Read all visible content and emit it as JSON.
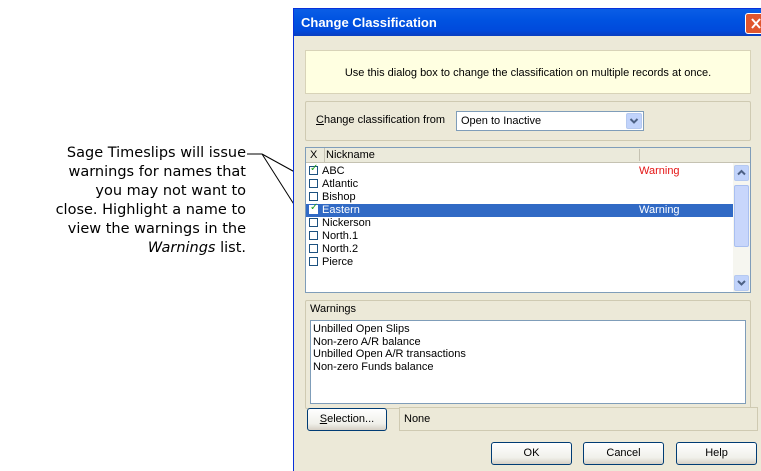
{
  "callout": {
    "line1": "Sage Timeslips will issue",
    "line2": "warnings for names that",
    "line3": "you may not want to",
    "line4": "close. Highlight a name to",
    "line5": "view the warnings in the",
    "line6_italic": "Warnings",
    "line6_rest": " list."
  },
  "dialog": {
    "title": "Change Classification",
    "info_text": "Use this dialog box to change the classification on multiple records at once.",
    "from_label_u": "C",
    "from_label_rest": "hange classification from",
    "from_value": "Open to Inactive",
    "list_header_x": "X",
    "list_header_name": "Nickname",
    "rows": [
      {
        "name": "ABC",
        "checked": true,
        "warning": "Warning",
        "selected": false
      },
      {
        "name": "Atlantic",
        "checked": false,
        "warning": "",
        "selected": false
      },
      {
        "name": "Bishop",
        "checked": false,
        "warning": "",
        "selected": false
      },
      {
        "name": "Eastern",
        "checked": true,
        "warning": "Warning",
        "selected": true
      },
      {
        "name": "Nickerson",
        "checked": false,
        "warning": "",
        "selected": false
      },
      {
        "name": "North.1",
        "checked": false,
        "warning": "",
        "selected": false
      },
      {
        "name": "North.2",
        "checked": false,
        "warning": "",
        "selected": false
      },
      {
        "name": "Pierce",
        "checked": false,
        "warning": "",
        "selected": false
      }
    ],
    "warnings_title": "Warnings",
    "warnings": [
      "Unbilled Open Slips",
      "Non-zero A/R balance",
      "Unbilled Open A/R transactions",
      "Non-zero Funds balance"
    ],
    "selection_button_u": "S",
    "selection_button_rest": "election...",
    "selection_value": "None",
    "ok_label": "OK",
    "cancel_label": "Cancel",
    "help_label": "Help"
  },
  "colors": {
    "title_bar": "#0054e3",
    "selection": "#316ac5",
    "warning_text": "#e51515",
    "info_background": "#ffffe1"
  }
}
